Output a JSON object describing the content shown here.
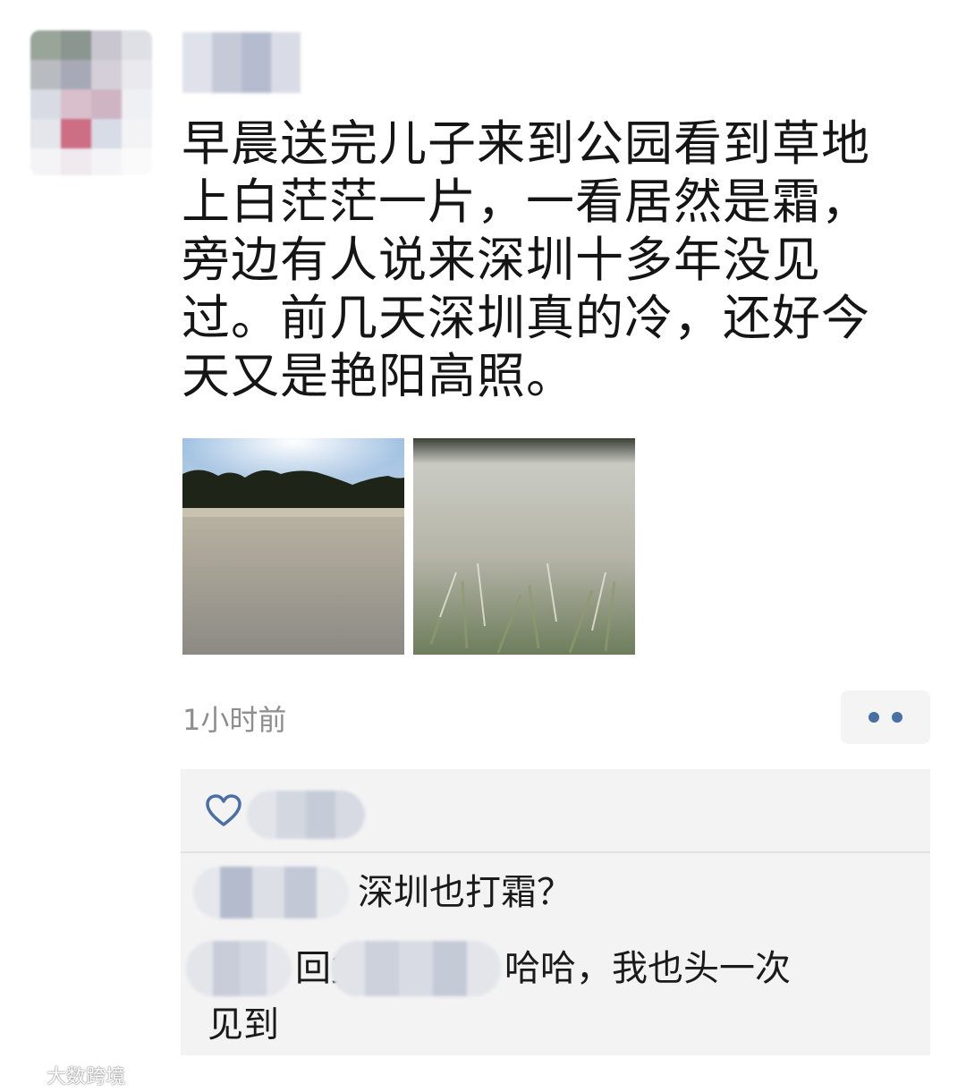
{
  "post": {
    "text": "早晨送完儿子来到公园看到草地\n上白茫茫一片，一看居然是霜，\n旁边有人说来深圳十多年没见\n过。前几天深圳真的冷，还好今\n天又是艳阳高照。",
    "timestamp": "1小时前"
  },
  "photos": [
    {
      "icon": "frosted-park-lawn-photo"
    },
    {
      "icon": "frosted-grass-closeup-photo"
    }
  ],
  "actions": {
    "more_icon": "more-dots-icon",
    "accent_color": "#4a6fa5"
  },
  "likes": {
    "icon": "heart-icon"
  },
  "comments": [
    {
      "text": "深圳也打霜？"
    },
    {
      "reply_word": "回复",
      "text_line1": "哈哈，我也头一次",
      "text_line2": "见到"
    }
  ],
  "watermark": {
    "text": "大数跨境"
  }
}
